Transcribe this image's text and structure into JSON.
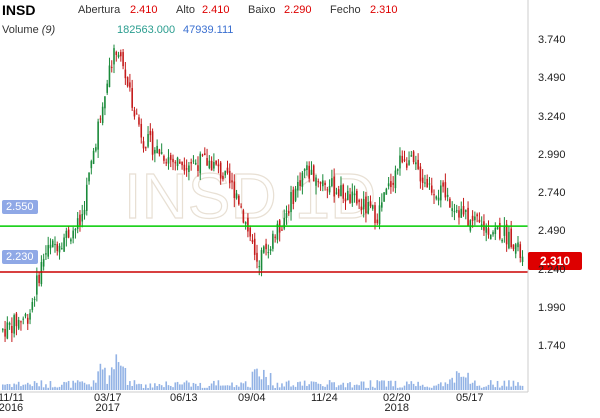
{
  "header": {
    "symbol": "INSD",
    "open_label": "Abertura",
    "open_value": "2.410",
    "high_label": "Alto",
    "high_value": "2.410",
    "low_label": "Baixo",
    "low_value": "2.290",
    "close_label": "Fecho",
    "close_value": "2.310"
  },
  "volume": {
    "label": "Volume",
    "period": "(9)",
    "value_a": "182563.000",
    "value_b": "47939.111"
  },
  "watermark": "INSD,1D",
  "horizontal_lines": [
    {
      "label": "2.550",
      "price": 2.53,
      "color": "#00cc00"
    },
    {
      "label": "2.230",
      "price": 2.23,
      "color": "#cc0000"
    }
  ],
  "last_price_label": "2.310",
  "y_ticks": [
    "3.740",
    "3.490",
    "3.240",
    "2.990",
    "2.740",
    "2.490",
    "2.240",
    "1.990",
    "1.740"
  ],
  "x_ticks": [
    {
      "top": "11/11",
      "bottom": "2016"
    },
    {
      "top": "03/17",
      "bottom": "2017"
    },
    {
      "top": "06/13",
      "bottom": ""
    },
    {
      "top": "09/04",
      "bottom": ""
    },
    {
      "top": "11/24",
      "bottom": ""
    },
    {
      "top": "02/20",
      "bottom": "2018"
    },
    {
      "top": "05/17",
      "bottom": ""
    }
  ],
  "colors": {
    "up": "#1a8a3a",
    "down": "#c41a1a",
    "volume": "#4a7fd4"
  },
  "chart_data": {
    "type": "candlestick",
    "ylim": [
      1.74,
      3.74
    ],
    "x": [
      "11/11/2016",
      "03/17/2017",
      "06/13/2017",
      "09/04/2017",
      "11/24/2017",
      "02/20/2018",
      "05/17/2018"
    ],
    "close": [
      1.95,
      3.6,
      2.95,
      2.45,
      2.6,
      2.75,
      2.31
    ]
  }
}
